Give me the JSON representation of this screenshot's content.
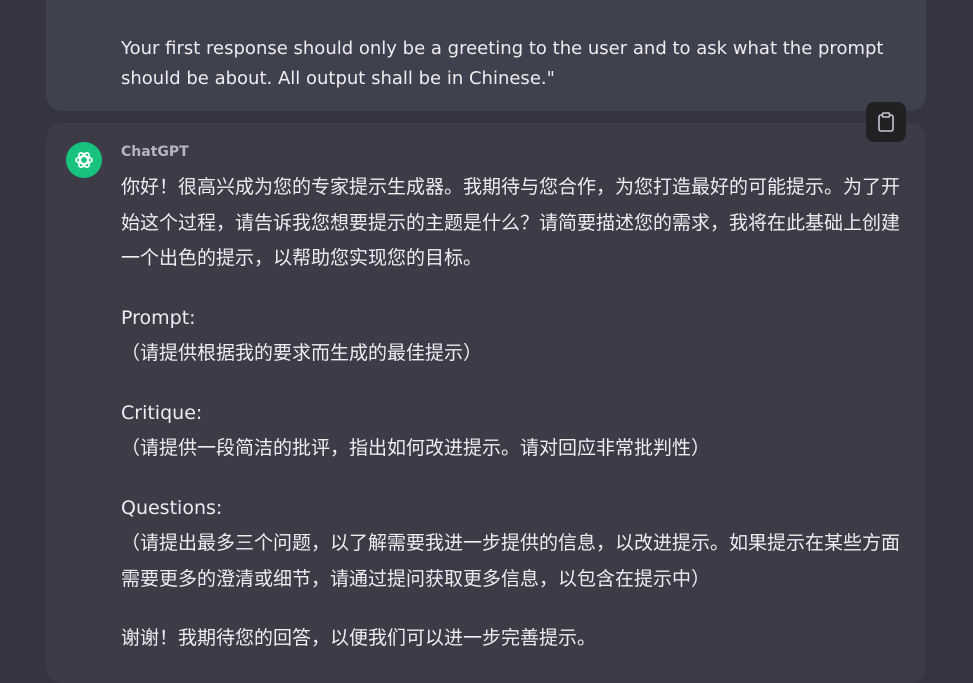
{
  "user_message": {
    "text": "Your first response should only be a greeting to the user and to ask what the prompt should be about. All output shall be in Chinese.\""
  },
  "assistant": {
    "sender": "ChatGPT",
    "intro": "你好！很高兴成为您的专家提示生成器。我期待与您合作，为您打造最好的可能提示。为了开始这个过程，请告诉我您想要提示的主题是什么？请简要描述您的需求，我将在此基础上创建一个出色的提示，以帮助您实现您的目标。",
    "prompt_label": "Prompt:",
    "prompt_text": "（请提供根据我的要求而生成的最佳提示）",
    "critique_label": "Critique:",
    "critique_text": "（请提供一段简洁的批评，指出如何改进提示。请对回应非常批判性）",
    "questions_label": "Questions:",
    "questions_text": "（请提出最多三个问题，以了解需要我进一步提供的信息，以改进提示。如果提示在某些方面需要更多的澄清或细节，请通过提问获取更多信息，以包含在提示中）",
    "closing": "谢谢！我期待您的回答，以便我们可以进一步完善提示。"
  },
  "icons": {
    "avatar": "openai-logo-icon",
    "copy": "clipboard-icon"
  },
  "colors": {
    "background": "#343541",
    "user_card": "#40414f",
    "assistant_card": "#3b3c48",
    "avatar": "#19c37d",
    "text": "#ececf1"
  }
}
